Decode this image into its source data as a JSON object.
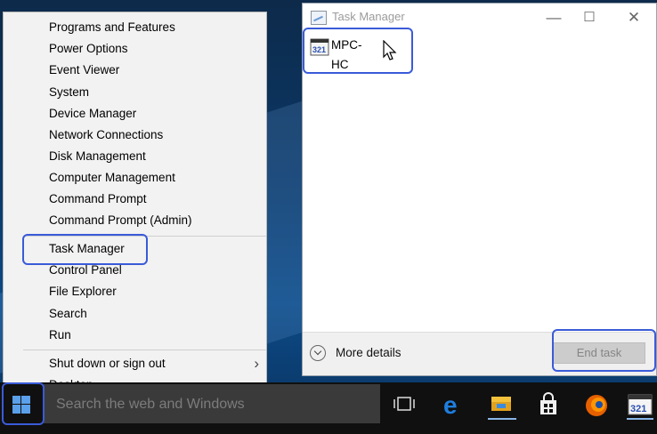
{
  "winx_menu": {
    "items": [
      {
        "label": "Programs and Features"
      },
      {
        "label": "Power Options"
      },
      {
        "label": "Event Viewer"
      },
      {
        "label": "System"
      },
      {
        "label": "Device Manager"
      },
      {
        "label": "Network Connections"
      },
      {
        "label": "Disk Management"
      },
      {
        "label": "Computer Management"
      },
      {
        "label": "Command Prompt"
      },
      {
        "label": "Command Prompt (Admin)"
      },
      {
        "label": "Task Manager"
      },
      {
        "label": "Control Panel"
      },
      {
        "label": "File Explorer"
      },
      {
        "label": "Search"
      },
      {
        "label": "Run"
      },
      {
        "label": "Shut down or sign out"
      },
      {
        "label": "Desktop"
      }
    ]
  },
  "task_manager": {
    "title": "Task Manager",
    "process": {
      "name": "MPC-HC",
      "icon": "mpc-hc-icon"
    },
    "more_details": "More details",
    "end_task": "End task"
  },
  "taskbar": {
    "search_placeholder": "Search the web and Windows",
    "icons": [
      "windows-logo-icon",
      "task-view-icon",
      "edge-icon",
      "file-explorer-icon",
      "store-icon",
      "firefox-icon",
      "mpc-hc-icon"
    ]
  },
  "colors": {
    "highlight": "#3a5bd8",
    "taskbar": "#101010"
  }
}
